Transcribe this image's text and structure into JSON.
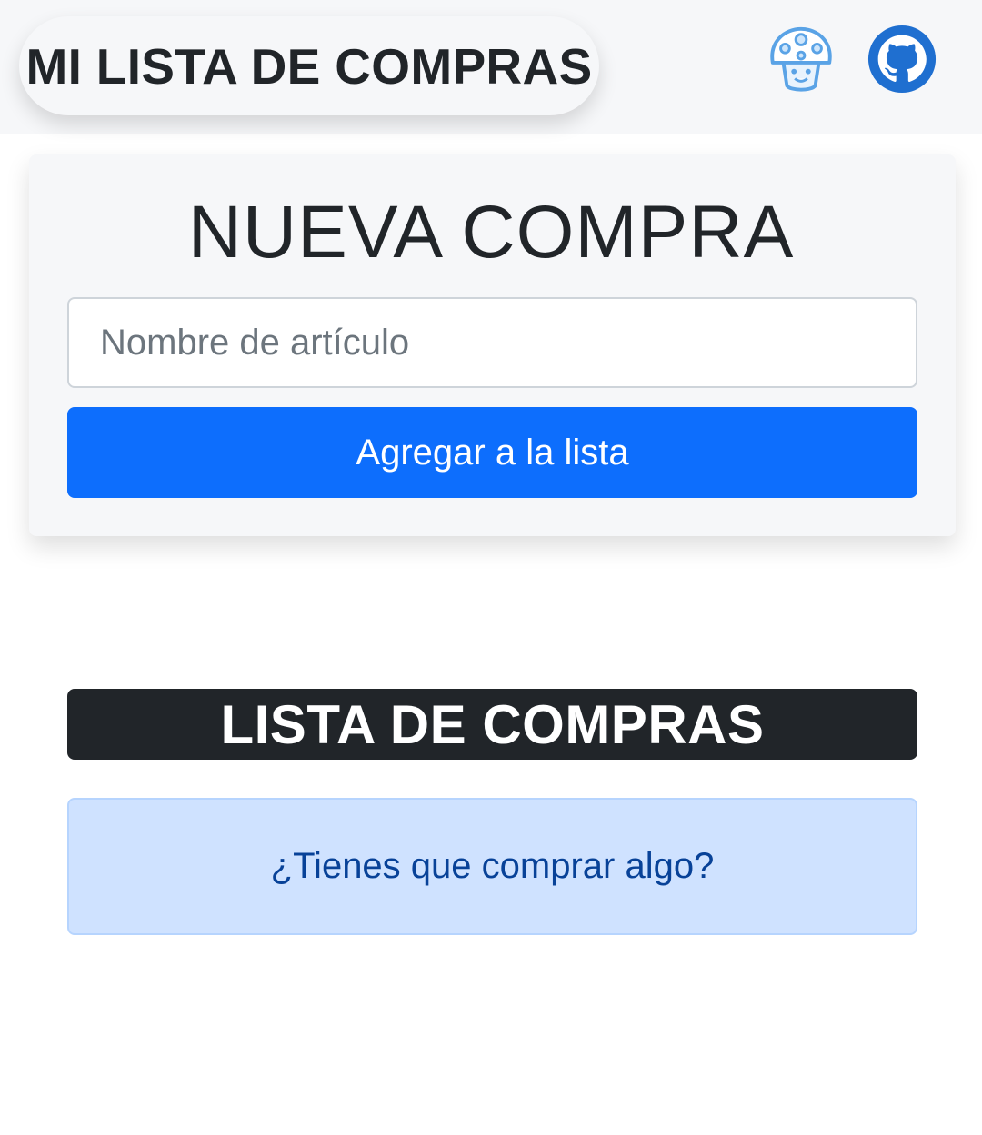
{
  "navbar": {
    "brand": "MI LISTA DE COMPRAS",
    "icons": [
      "mushroom-icon",
      "github-icon"
    ],
    "accent": "#0d6efd"
  },
  "form": {
    "title": "NUEVA COMPRA",
    "input_value": "",
    "input_placeholder": "Nombre de artículo",
    "submit_label": "Agregar a la lista"
  },
  "list": {
    "title": "LISTA DE COMPRAS",
    "empty_message": "¿Tienes que comprar algo?"
  },
  "colors": {
    "primary_button": "#0d6efd",
    "list_header": "#212529",
    "alert_bg": "#cfe2ff",
    "alert_text": "#084298"
  }
}
